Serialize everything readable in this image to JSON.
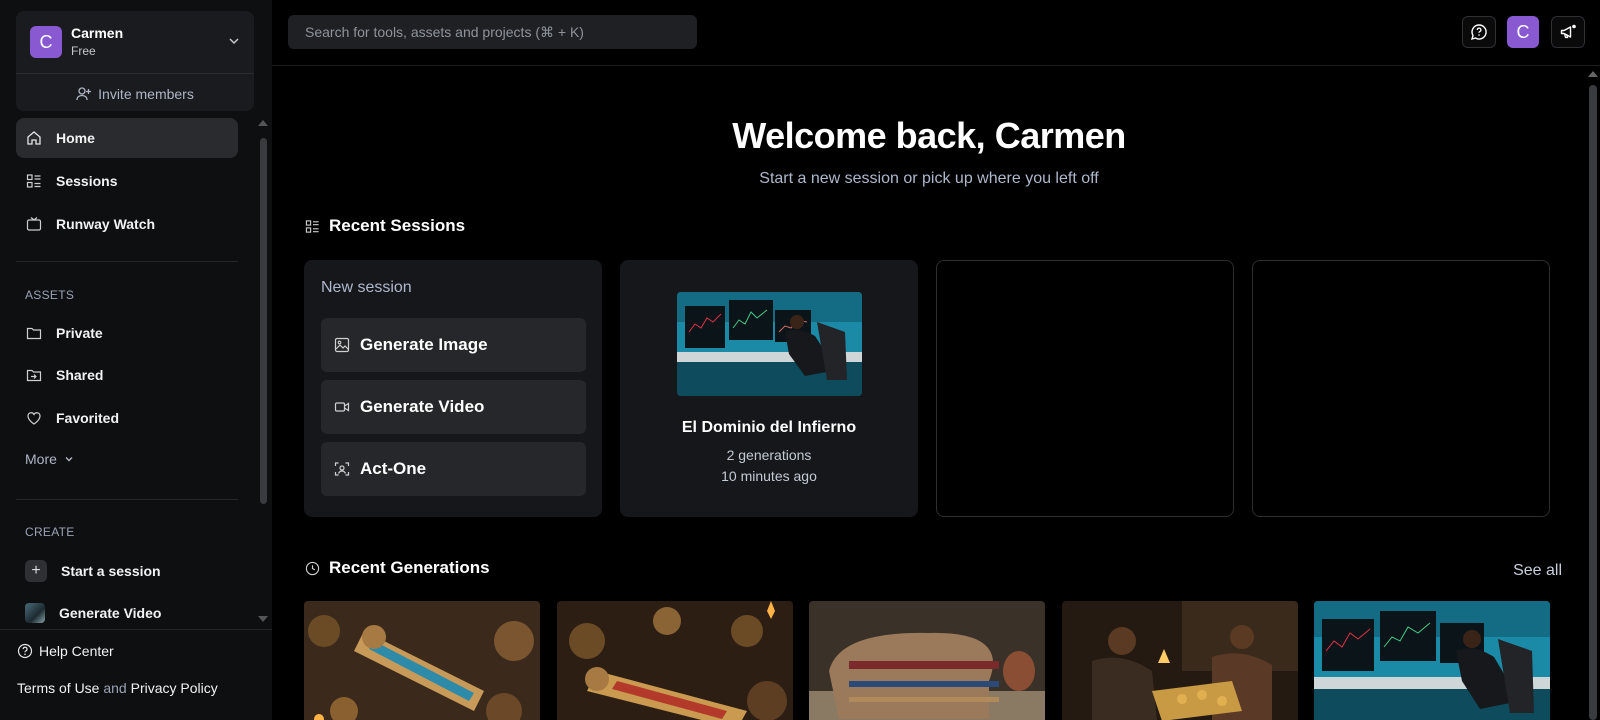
{
  "workspace": {
    "avatar_letter": "C",
    "name": "Carmen",
    "plan": "Free",
    "invite_label": "Invite members",
    "chevron_icon": "chevron-down-icon"
  },
  "nav": {
    "items": [
      {
        "label": "Home",
        "icon": "home-icon",
        "active": true
      },
      {
        "label": "Sessions",
        "icon": "sessions-icon"
      },
      {
        "label": "Runway Watch",
        "icon": "tv-icon"
      }
    ]
  },
  "assets": {
    "heading": "ASSETS",
    "items": [
      {
        "label": "Private",
        "icon": "folder-icon"
      },
      {
        "label": "Shared",
        "icon": "shared-folder-icon"
      },
      {
        "label": "Favorited",
        "icon": "heart-icon"
      }
    ],
    "more_label": "More"
  },
  "create": {
    "heading": "CREATE",
    "items": [
      {
        "label": "Start a session",
        "icon": "plus-icon"
      },
      {
        "label": "Generate Video",
        "icon": "video-thumbnail-icon"
      }
    ]
  },
  "footer": {
    "help_label": "Help Center",
    "terms_label": "Terms of Use",
    "and_label": "and",
    "privacy_label": "Privacy Policy"
  },
  "topbar": {
    "search_placeholder": "Search for tools, assets and projects (⌘ + K)",
    "avatar_letter": "C",
    "buttons": [
      "feedback-chat-icon",
      "announcement-megaphone-icon"
    ]
  },
  "main": {
    "welcome": "Welcome back, Carmen",
    "subtitle": "Start a new session or pick up where you left off",
    "recent_sessions_heading": "Recent Sessions",
    "new_session": {
      "title": "New session",
      "actions": [
        {
          "label": "Generate Image",
          "icon": "image-icon"
        },
        {
          "label": "Generate Video",
          "icon": "video-camera-icon"
        },
        {
          "label": "Act-One",
          "icon": "face-scan-icon"
        }
      ]
    },
    "sessions": [
      {
        "title": "El Dominio del Infierno",
        "generations": "2 generations",
        "time": "10 minutes ago"
      }
    ],
    "recent_generations_heading": "Recent Generations",
    "see_all_label": "See all"
  },
  "colors": {
    "background": "#000000",
    "sidebar": "#0e0f11",
    "card": "#16171a",
    "button": "#26272b",
    "accent_avatar": "#8859d0",
    "muted_text": "#aeb8cc"
  }
}
